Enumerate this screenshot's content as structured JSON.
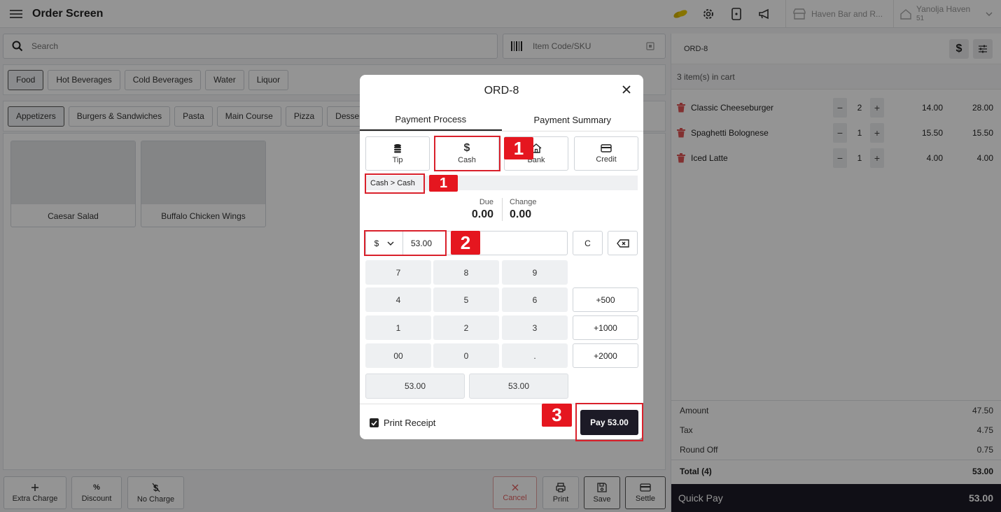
{
  "header": {
    "title": "Order Screen",
    "store": "Haven Bar and R...",
    "location_name": "Yanolja Haven",
    "location_sub": "51"
  },
  "search": {
    "placeholder": "Search"
  },
  "sku": {
    "placeholder": "Item Code/SKU"
  },
  "categories": [
    "Food",
    "Hot Beverages",
    "Cold Beverages",
    "Water",
    "Liquor"
  ],
  "subcategories": [
    "Appetizers",
    "Burgers & Sandwiches",
    "Pasta",
    "Main Course",
    "Pizza",
    "Desserts"
  ],
  "items": [
    "Caesar Salad",
    "Buffalo Chicken Wings"
  ],
  "bottom_actions": {
    "extra_charge": "Extra Charge",
    "discount": "Discount",
    "no_charge": "No Charge",
    "cancel": "Cancel",
    "print": "Print",
    "save": "Save",
    "settle": "Settle",
    "percent_symbol": "%"
  },
  "cart": {
    "order_id": "ORD-8",
    "count_text": "3 item(s) in cart",
    "items": [
      {
        "name": "Classic Cheeseburger",
        "qty": "2",
        "price": "14.00",
        "total": "28.00"
      },
      {
        "name": "Spaghetti Bolognese",
        "qty": "1",
        "price": "15.50",
        "total": "15.50"
      },
      {
        "name": "Iced Latte",
        "qty": "1",
        "price": "4.00",
        "total": "4.00"
      }
    ],
    "amount_label": "Amount",
    "amount": "47.50",
    "tax_label": "Tax",
    "tax": "4.75",
    "roundoff_label": "Round Off",
    "roundoff": "0.75",
    "total_label": "Total (4)",
    "total": "53.00",
    "quick_pay_label": "Quick Pay",
    "quick_pay_amount": "53.00",
    "currency_symbol": "$"
  },
  "modal": {
    "title": "ORD-8",
    "tabs": [
      "Payment Process",
      "Payment Summary"
    ],
    "methods": [
      "Tip",
      "Cash",
      "Bank",
      "Credit"
    ],
    "cash_symbol": "$",
    "breadcrumb": "Cash > Cash",
    "due_label": "Due",
    "due": "0.00",
    "change_label": "Change",
    "change": "0.00",
    "currency": "$",
    "amount": "53.00",
    "clear_label": "C",
    "keys": [
      "7",
      "8",
      "9",
      "4",
      "5",
      "6",
      "1",
      "2",
      "3",
      "00",
      "0",
      "."
    ],
    "quick_amounts": [
      "+500",
      "+1000",
      "+2000"
    ],
    "suggestions": [
      "53.00",
      "53.00"
    ],
    "print_receipt": "Print Receipt",
    "pay_label": "Pay 53.00"
  },
  "annotations": [
    "1",
    "1",
    "2",
    "3"
  ],
  "colors": {
    "accent_dark": "#1c1a26",
    "annotation_red": "#e5161f",
    "trash_red": "#e05555"
  }
}
